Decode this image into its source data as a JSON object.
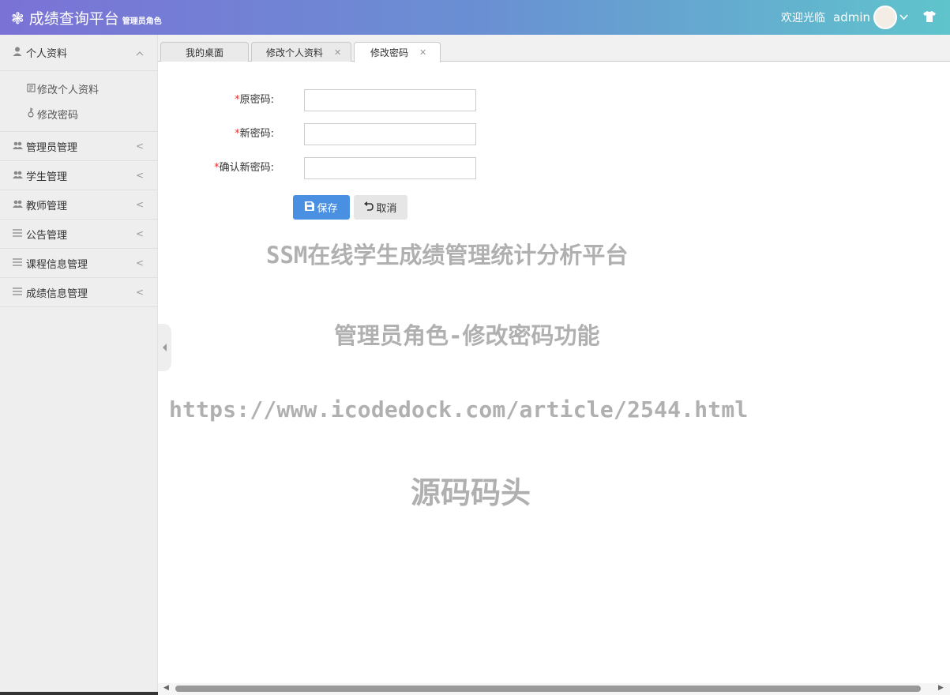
{
  "header": {
    "logo_icon": "❃",
    "title": "成绩查询平台",
    "subtitle": "管理员角色",
    "welcome": "欢迎光临",
    "username": "admin",
    "caret_icon": "chevron-down-icon",
    "theme_icon": "shirt-icon"
  },
  "sidebar": {
    "groups": [
      {
        "label": "个人资料",
        "icon": "user-icon",
        "arrow": "^",
        "items": [
          {
            "label": "修改个人资料",
            "icon": "edit-icon"
          },
          {
            "label": "修改密码",
            "icon": "key-icon"
          }
        ]
      },
      {
        "label": "管理员管理",
        "icon": "users-icon",
        "arrow": "<"
      },
      {
        "label": "学生管理",
        "icon": "users-icon",
        "arrow": "<"
      },
      {
        "label": "教师管理",
        "icon": "users-icon",
        "arrow": "<"
      },
      {
        "label": "公告管理",
        "icon": "list-icon",
        "arrow": "<"
      },
      {
        "label": "课程信息管理",
        "icon": "list-icon",
        "arrow": "<"
      },
      {
        "label": "成绩信息管理",
        "icon": "list-icon",
        "arrow": "<"
      }
    ]
  },
  "tabs": [
    {
      "label": "我的桌面",
      "closable": false,
      "active": false
    },
    {
      "label": "修改个人资料",
      "closable": true,
      "active": false
    },
    {
      "label": "修改密码",
      "closable": true,
      "active": true
    }
  ],
  "form": {
    "required_mark": "*",
    "fields": [
      {
        "label": "原密码:",
        "value": ""
      },
      {
        "label": "新密码:",
        "value": ""
      },
      {
        "label": "确认新密码:",
        "value": ""
      }
    ],
    "save_label": "保存",
    "cancel_label": "取消"
  },
  "watermark": {
    "line1": "SSM在线学生成绩管理统计分析平台",
    "line2": "管理员角色-修改密码功能",
    "line3": "https://www.icodedock.com/article/2544.html",
    "line4": "源码码头"
  },
  "colors": {
    "header_gradient_start": "#7b72d6",
    "header_gradient_end": "#5fc4cc",
    "primary_button": "#4a90e2",
    "required": "#e33333"
  }
}
